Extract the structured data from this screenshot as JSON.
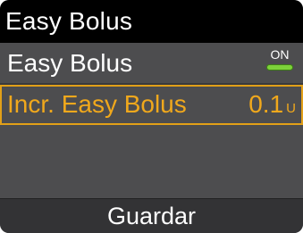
{
  "header": {
    "title": "Easy Bolus"
  },
  "settings": {
    "easy_bolus": {
      "label": "Easy Bolus",
      "toggle_state": "ON",
      "toggle_color": "#7dd33a"
    },
    "increment": {
      "label": "Incr. Easy Bolus",
      "value": "0.1",
      "unit": "U",
      "highlight_color": "#f0a81c"
    }
  },
  "footer": {
    "save_label": "Guardar"
  }
}
